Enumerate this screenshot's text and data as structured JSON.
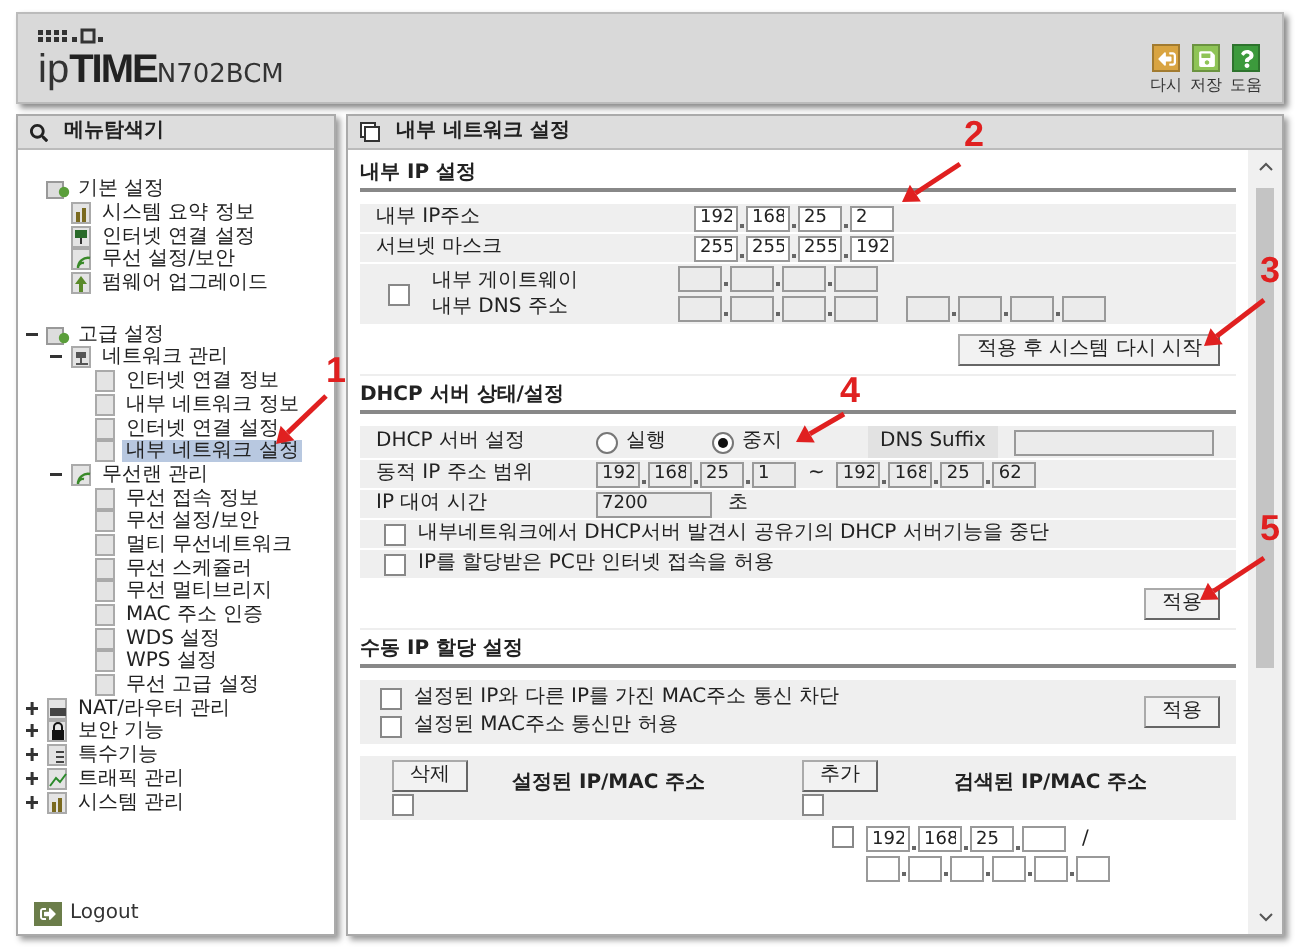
{
  "header": {
    "logo": "ip**TIME**",
    "model": "N702BCM",
    "tools": [
      {
        "kind": "reload",
        "label": "다시",
        "color": "#d9a441"
      },
      {
        "kind": "save",
        "label": "저장",
        "color": "#8fc456"
      },
      {
        "kind": "help",
        "label": "도움",
        "color": "#3c9a3c"
      }
    ]
  },
  "sidebar": {
    "title": "메뉴탐색기",
    "tree": [
      {
        "label": "기본 설정",
        "kind": "folder",
        "children": [
          {
            "label": "시스템 요약 정보",
            "kind": "chart",
            "selected": false
          },
          {
            "label": "인터넷 연결 설정",
            "kind": "monitor",
            "selected": false
          },
          {
            "label": "무선 설정/보안",
            "kind": "wifi",
            "selected": false
          },
          {
            "label": "펌웨어 업그레이드",
            "kind": "upgrade",
            "selected": false
          }
        ]
      },
      {
        "label": "고급 설정",
        "kind": "folder",
        "expanded": true,
        "children": [
          {
            "label": "네트워크 관리",
            "kind": "network",
            "expanded": true,
            "children": [
              {
                "label": "인터넷 연결 정보",
                "kind": "page",
                "selected": false
              },
              {
                "label": "내부 네트워크 정보",
                "kind": "page",
                "selected": false
              },
              {
                "label": "인터넷 연결 설정",
                "kind": "page",
                "selected": false
              },
              {
                "label": "내부 네트워크 설정",
                "kind": "page",
                "selected": true
              }
            ]
          },
          {
            "label": "무선랜 관리",
            "kind": "wifi",
            "expanded": true,
            "children": [
              {
                "label": "무선 접속 정보",
                "kind": "page",
                "selected": false
              },
              {
                "label": "무선 설정/보안",
                "kind": "page",
                "selected": false
              },
              {
                "label": "멀티 무선네트워크",
                "kind": "page",
                "selected": false
              },
              {
                "label": "무선 스케쥴러",
                "kind": "page",
                "selected": false
              },
              {
                "label": "무선 멀티브리지",
                "kind": "page",
                "selected": false
              },
              {
                "label": "MAC 주소 인증",
                "kind": "page",
                "selected": false
              },
              {
                "label": "WDS 설정",
                "kind": "page",
                "selected": false
              },
              {
                "label": "WPS 설정",
                "kind": "page",
                "selected": false
              },
              {
                "label": "무선 고급 설정",
                "kind": "page",
                "selected": false
              }
            ]
          }
        ]
      },
      {
        "label": "NAT/라우터 관리",
        "kind": "router",
        "expanded": false
      },
      {
        "label": "보안 기능",
        "kind": "lock",
        "expanded": false
      },
      {
        "label": "특수기능",
        "kind": "tools",
        "expanded": false
      },
      {
        "label": "트래픽 관리",
        "kind": "graph",
        "expanded": false
      },
      {
        "label": "시스템 관리",
        "kind": "chart",
        "expanded": false
      }
    ],
    "logout": "Logout"
  },
  "main": {
    "title": "내부 네트워크 설정",
    "lan": {
      "heading": "내부 IP 설정",
      "ip": {
        "label": "내부 IP주소",
        "octets": [
          "192",
          "168",
          "25",
          "2"
        ]
      },
      "mask": {
        "label": "서브넷 마스크",
        "octets": [
          "255",
          "255",
          "255",
          "192"
        ]
      },
      "gateway": {
        "checked": false,
        "gateway_label": "내부 게이트웨이",
        "dns_label": "내부 DNS 주소",
        "disabled": true
      },
      "button": "적용 후 시스템 다시 시작"
    },
    "dhcp": {
      "heading": "DHCP 서버 상태/설정",
      "server_label": "DHCP 서버 설정",
      "modes": [
        {
          "label": "실행",
          "selected": false
        },
        {
          "label": "중지",
          "selected": true
        }
      ],
      "suffix_label": "DNS Suffix",
      "range_label": "동적 IP 주소 범위",
      "range_start": [
        "192",
        "168",
        "25",
        "1"
      ],
      "range_sep": "~",
      "range_end": [
        "192",
        "168",
        "25",
        "62"
      ],
      "lease_label": "IP 대여 시간",
      "lease": "7200",
      "lease_unit": "초",
      "disabled": true,
      "options": [
        {
          "label": "내부네트워크에서 DHCP서버 발견시 공유기의 DHCP 서버기능을 중단",
          "checked": false
        },
        {
          "label": "IP를 할당받은 PC만 인터넷 접속을 허용",
          "checked": false
        }
      ],
      "button": "적용"
    },
    "manual": {
      "heading": "수동 IP 할당 설정",
      "options": [
        {
          "label": "설정된 IP와 다른 IP를 가진 MAC주소 통신 차단",
          "checked": false
        },
        {
          "label": "설정된 MAC주소 통신만 허용",
          "checked": false
        }
      ],
      "button": "적용",
      "configured": {
        "button": "삭제",
        "checked": false,
        "title": "설정된 IP/MAC 주소"
      },
      "detected": {
        "button": "추가",
        "checked": false,
        "title": "검색된 IP/MAC 주소",
        "rows": [
          {
            "checked": false,
            "octets": [
              "192",
              "168",
              "25"
            ],
            "sep": "/"
          }
        ]
      }
    }
  },
  "annotations": [
    {
      "label": "1"
    },
    {
      "label": "2"
    },
    {
      "label": "3"
    },
    {
      "label": "4"
    },
    {
      "label": "5"
    }
  ]
}
